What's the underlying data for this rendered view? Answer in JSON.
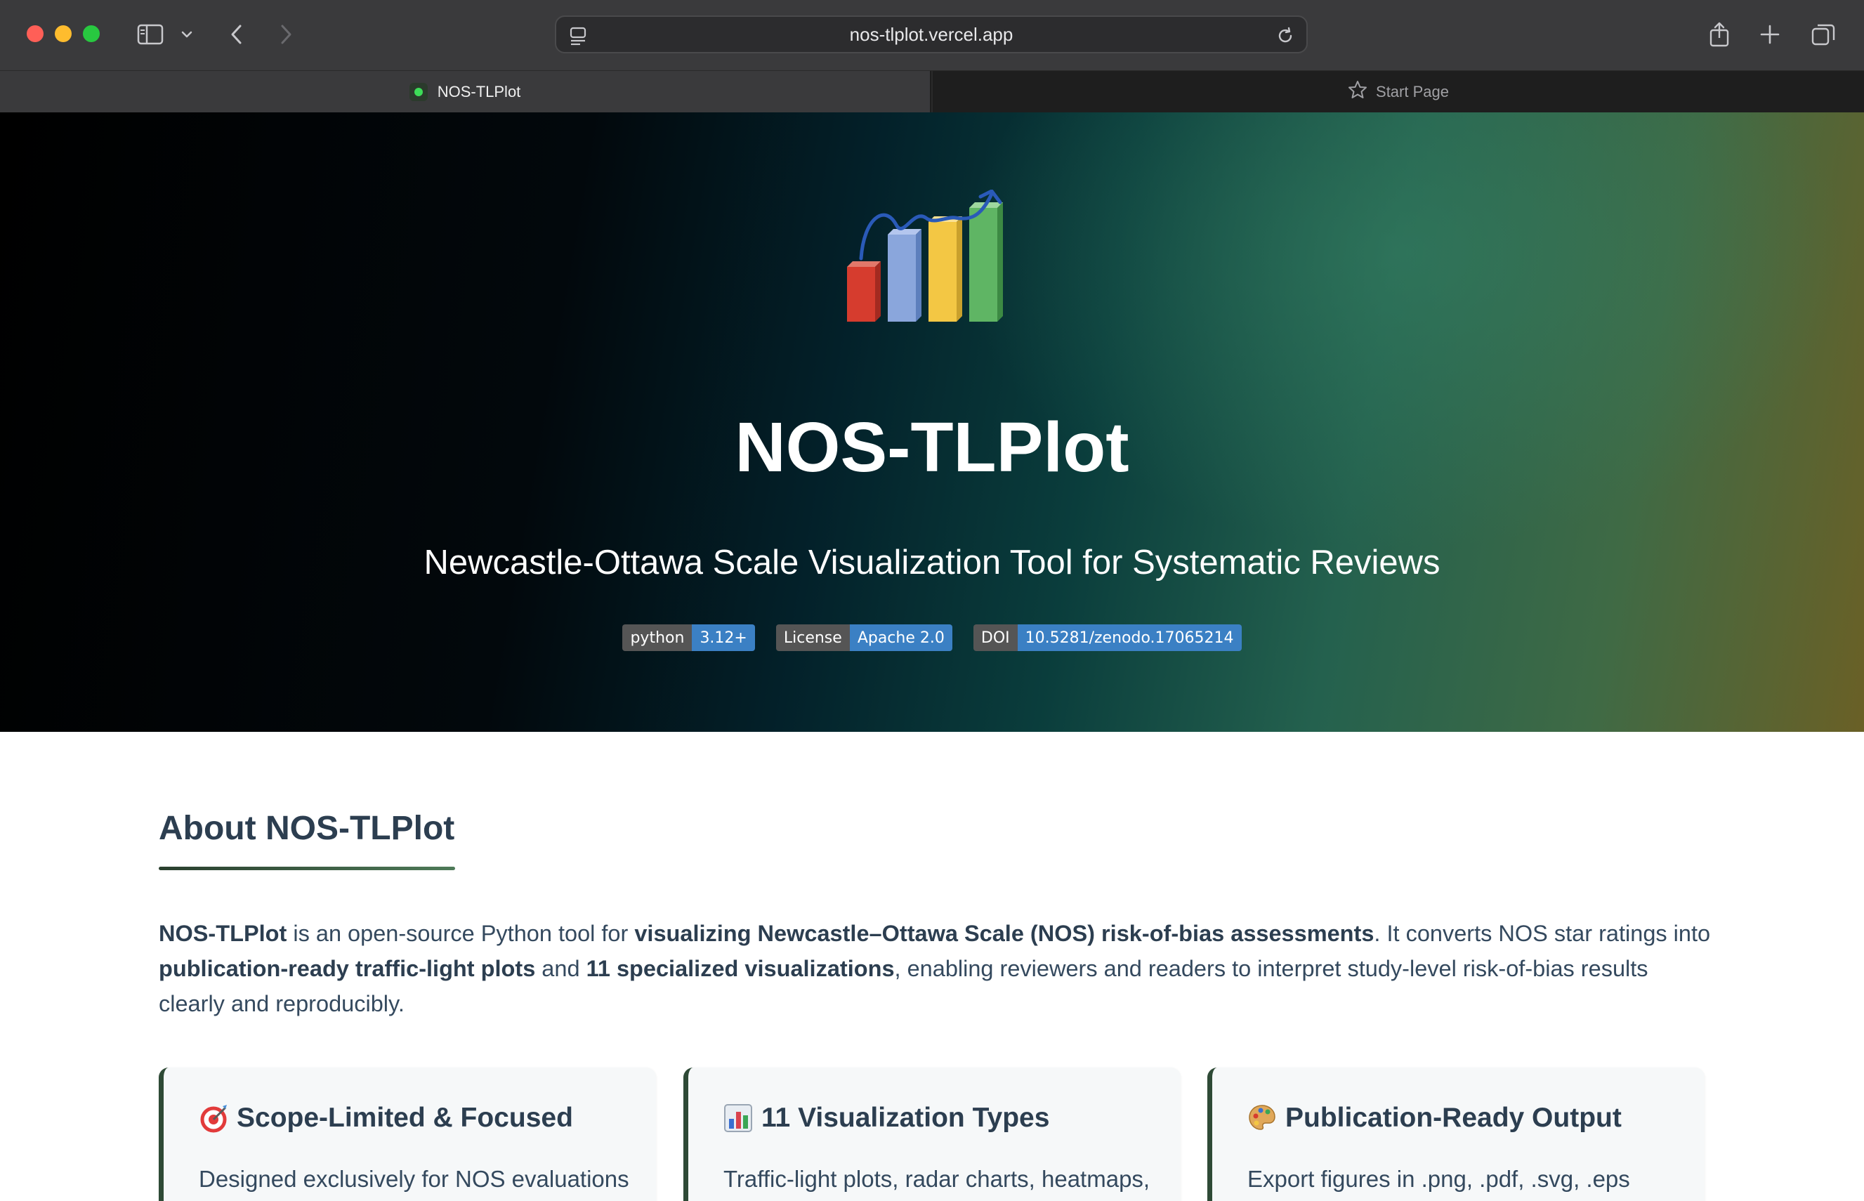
{
  "browser": {
    "url": "nos-tlplot.vercel.app",
    "tabs": [
      {
        "label": "NOS-TLPlot",
        "active": true
      },
      {
        "label": "Start Page",
        "active": false
      }
    ]
  },
  "hero": {
    "title": "NOS-TLPlot",
    "subtitle": "Newcastle-Ottawa Scale Visualization Tool for Systematic Reviews",
    "badges": [
      {
        "label": "python",
        "value": "3.12+"
      },
      {
        "label": "License",
        "value": "Apache 2.0"
      },
      {
        "label": "DOI",
        "value": "10.5281/zenodo.17065214"
      }
    ]
  },
  "about": {
    "heading": "About NOS-TLPlot",
    "intro": {
      "p1": "NOS-TLPlot",
      "p2": " is an open-source Python tool for ",
      "p3": "visualizing Newcastle–Ottawa Scale (NOS) risk-of-bias assessments",
      "p4": ". It converts NOS star ratings into ",
      "p5": "publication-ready traffic-light plots",
      "p6": " and ",
      "p7": "11 specialized visualizations",
      "p8": ", enabling reviewers and readers to interpret study-level risk-of-bias results clearly and reproducibly."
    },
    "cards": [
      {
        "icon": "target-icon",
        "title": "Scope-Limited & Focused",
        "text": "Designed exclusively for NOS evaluations"
      },
      {
        "icon": "bar-chart-icon",
        "title": "11 Visualization Types",
        "text": "Traffic-light plots, radar charts, heatmaps,"
      },
      {
        "icon": "palette-icon",
        "title": "Publication-Ready Output",
        "text": "Export figures in .png, .pdf, .svg, .eps"
      }
    ]
  },
  "colors": {
    "accent": "#2e4a36",
    "badge_value": "#3b80c4",
    "badge_label": "#555555",
    "heading": "#2c3e50"
  }
}
